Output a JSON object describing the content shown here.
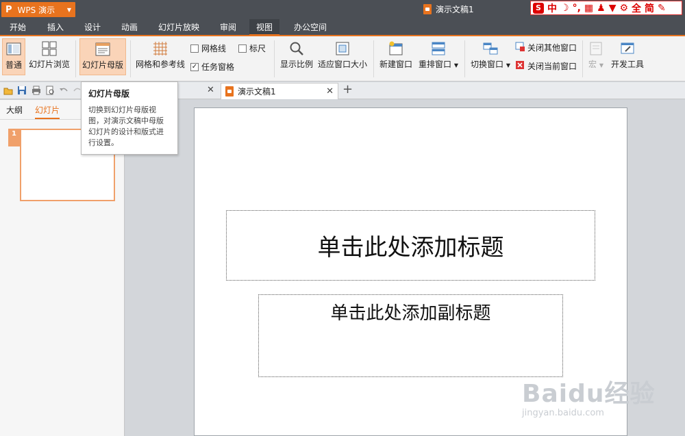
{
  "app": {
    "name": "WPS 演示",
    "logo": "P"
  },
  "window": {
    "doc_title": "演示文稿1"
  },
  "ime": {
    "s": "S",
    "lang": "中",
    "items": [
      "中",
      "☽",
      "°,",
      "▦",
      "♟",
      "▼",
      "⚙",
      "全",
      "简",
      "✎"
    ]
  },
  "menu": {
    "tabs": [
      {
        "label": "开始",
        "x": 0
      },
      {
        "label": "插入",
        "x": 1
      },
      {
        "label": "设计",
        "x": 2
      },
      {
        "label": "动画",
        "x": 3
      },
      {
        "label": "幻灯片放映",
        "x": 4
      },
      {
        "label": "审阅",
        "x": 5
      },
      {
        "label": "视图",
        "x": 6
      },
      {
        "label": "办公空间",
        "x": 7
      }
    ],
    "active": "视图"
  },
  "ribbon": {
    "normal": "普通",
    "slide_sorter": "幻灯片浏览",
    "slide_master": "幻灯片母版",
    "grid_guides": "网格和参考线",
    "gridlines": "网格线",
    "ruler": "标尺",
    "task_pane": "任务窗格",
    "zoom": "显示比例",
    "fit_window": "适应窗口大小",
    "new_window": "新建窗口",
    "arrange": "重排窗口",
    "switch_window": "切换窗口",
    "close_others": "关闭其他窗口",
    "close_current": "关闭当前窗口",
    "macro": "宏",
    "dev_tools": "开发工具"
  },
  "tabs": {
    "doc_tab": "演示文稿1",
    "close": "✕",
    "add": "+"
  },
  "left_panel": {
    "tab_outline": "大纲",
    "tab_slides": "幻灯片",
    "slide_number": "1"
  },
  "tooltip": {
    "title": "幻灯片母版",
    "body": "切换到幻灯片母版视图，对演示文稿中母版幻灯片的设计和版式进行设置。"
  },
  "slide": {
    "title_placeholder": "单击此处添加标题",
    "subtitle_placeholder": "单击此处添加副标题"
  },
  "watermark": {
    "brand": "Baidu经验",
    "url": "jingyan.baidu.com"
  },
  "colors": {
    "accent": "#e8731e",
    "titlebar": "#4b4f55"
  }
}
